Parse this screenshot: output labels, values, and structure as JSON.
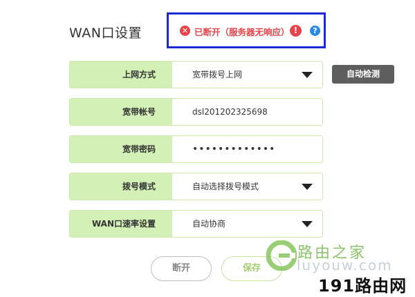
{
  "page": {
    "title": "WAN口设置"
  },
  "status": {
    "text": "已断开（服务器无响应）",
    "error_icon": "x-circle-icon",
    "warning_icon": "exclamation-circle-icon",
    "help_icon": "question-circle-icon",
    "error_glyph": "✕",
    "warning_glyph": "!",
    "help_glyph": "?",
    "error_color": "#e8434b",
    "help_color": "#2b8be0",
    "box_border_color": "#1a2ad9"
  },
  "form": {
    "connection_type": {
      "label": "上网方式",
      "value": "宽带拨号上网"
    },
    "account": {
      "label": "宽带帐号",
      "value": "dsl201202325698"
    },
    "password": {
      "label": "宽带密码",
      "value": "•••••••••••••"
    },
    "dial_mode": {
      "label": "拨号模式",
      "value": "自动选择拨号模式"
    },
    "wan_speed": {
      "label": "WAN口速率设置",
      "value": "自动协商"
    }
  },
  "buttons": {
    "auto_detect": "自动检测",
    "disconnect": "断开",
    "save": "保存"
  },
  "watermark": {
    "name": "路由之家",
    "site_text": "luyouw.com",
    "domain": "191路由网"
  },
  "colors": {
    "label_bg": "#d3f1b6",
    "row_border": "#cfe8b0",
    "auto_btn_bg": "#5e5e5e"
  }
}
